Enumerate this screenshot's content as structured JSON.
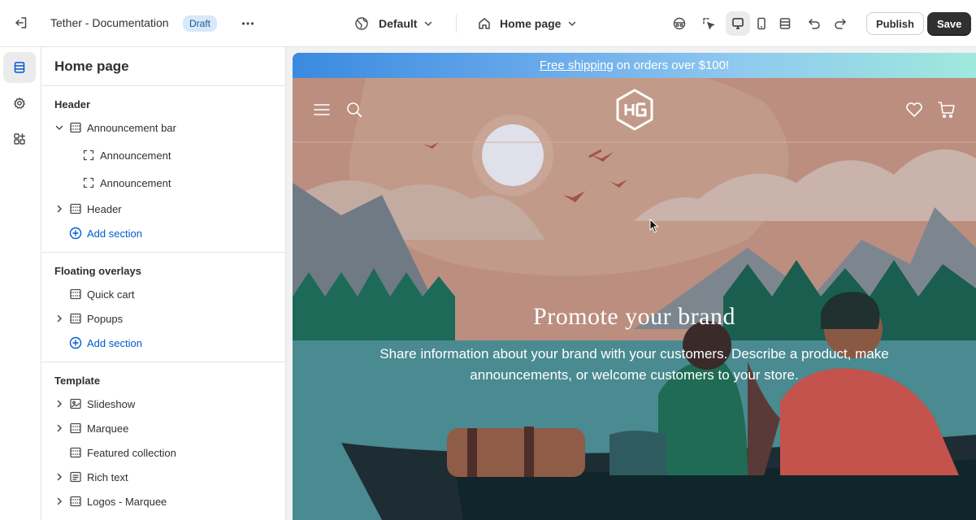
{
  "topbar": {
    "store_title": "Tether - Documentation",
    "status_badge": "Draft",
    "theme_select": "Default",
    "page_select": "Home page",
    "publish_label": "Publish",
    "save_label": "Save"
  },
  "sidebar": {
    "title": "Home page",
    "groups": {
      "header": {
        "label": "Header",
        "items": [
          "Announcement bar",
          "Announcement",
          "Announcement",
          "Header"
        ],
        "add": "Add section"
      },
      "overlays": {
        "label": "Floating overlays",
        "items": [
          "Quick cart",
          "Popups"
        ],
        "add": "Add section"
      },
      "template": {
        "label": "Template",
        "items": [
          "Slideshow",
          "Marquee",
          "Featured collection",
          "Rich text",
          "Logos - Marquee"
        ]
      }
    }
  },
  "preview": {
    "announcement_link": "Free shipping",
    "announcement_rest": "on orders over $100!",
    "hero_heading": "Promote your brand",
    "hero_text": "Share information about your brand with your customers. Describe a product, make announcements, or welcome customers to your store."
  },
  "colors": {
    "accent_link": "#005bd3",
    "save_bg": "#303030",
    "badge_bg": "#d8e9f8"
  }
}
